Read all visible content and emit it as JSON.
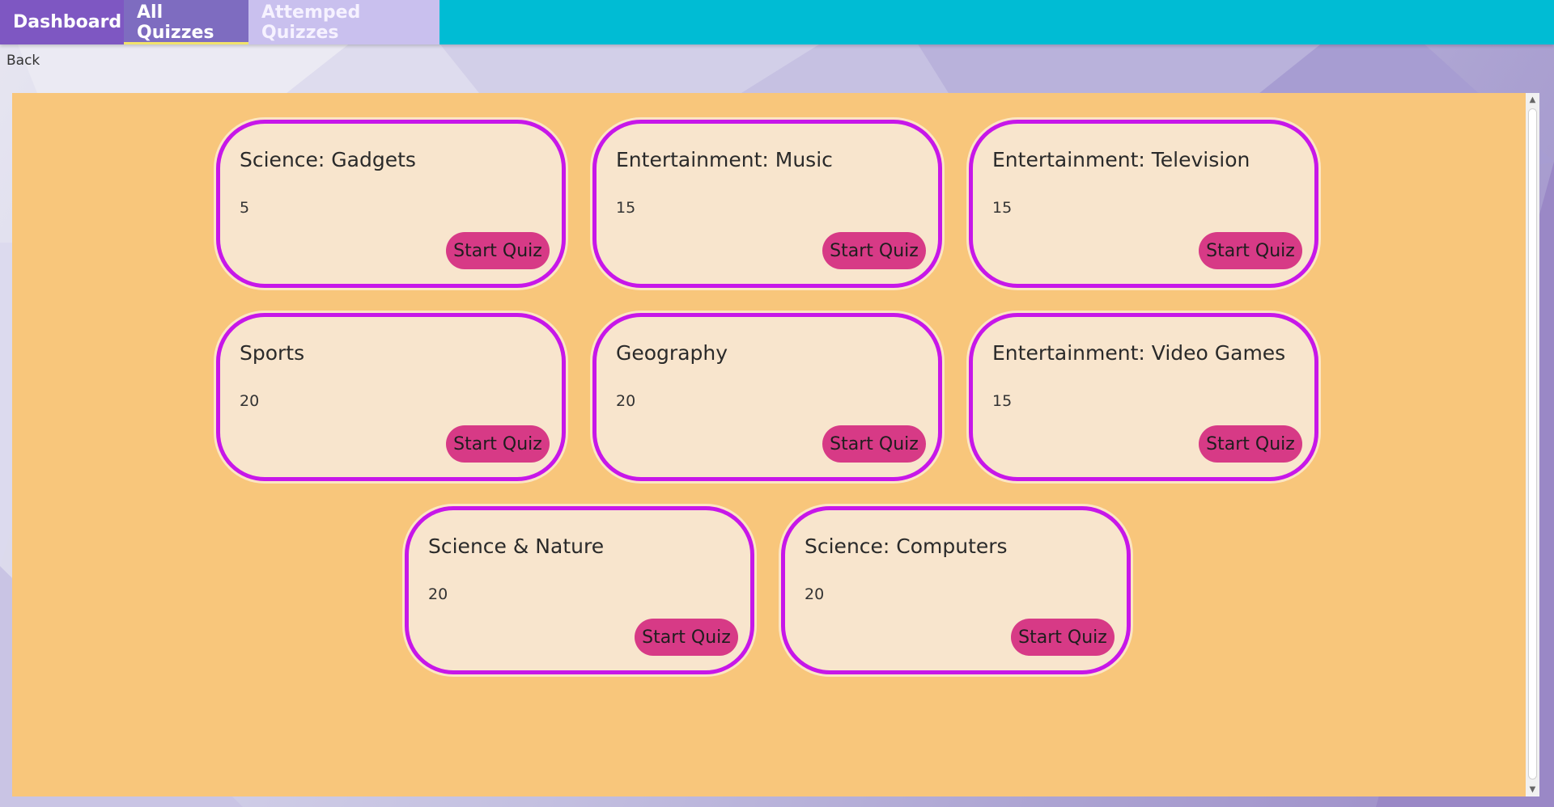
{
  "nav": {
    "tabs": [
      {
        "label": "Dashboard"
      },
      {
        "label": "All Quizzes"
      },
      {
        "label": "Attemped Quizzes"
      }
    ]
  },
  "back_label": "Back",
  "button_label": "Start Quiz",
  "quizzes": [
    {
      "title": "Science: Gadgets",
      "count": "5"
    },
    {
      "title": "Entertainment: Music",
      "count": "15"
    },
    {
      "title": "Entertainment: Television",
      "count": "15"
    },
    {
      "title": "Sports",
      "count": "20"
    },
    {
      "title": "Geography",
      "count": "20"
    },
    {
      "title": "Entertainment: Video Games",
      "count": "15"
    },
    {
      "title": "Science & Nature",
      "count": "20"
    },
    {
      "title": "Science: Computers",
      "count": "20"
    }
  ],
  "colors": {
    "topbar": "#00bcd4",
    "panel": "#f8c67b",
    "card_bg": "#f8e5cd",
    "card_border": "#c717e9",
    "button": "#d73a86"
  }
}
